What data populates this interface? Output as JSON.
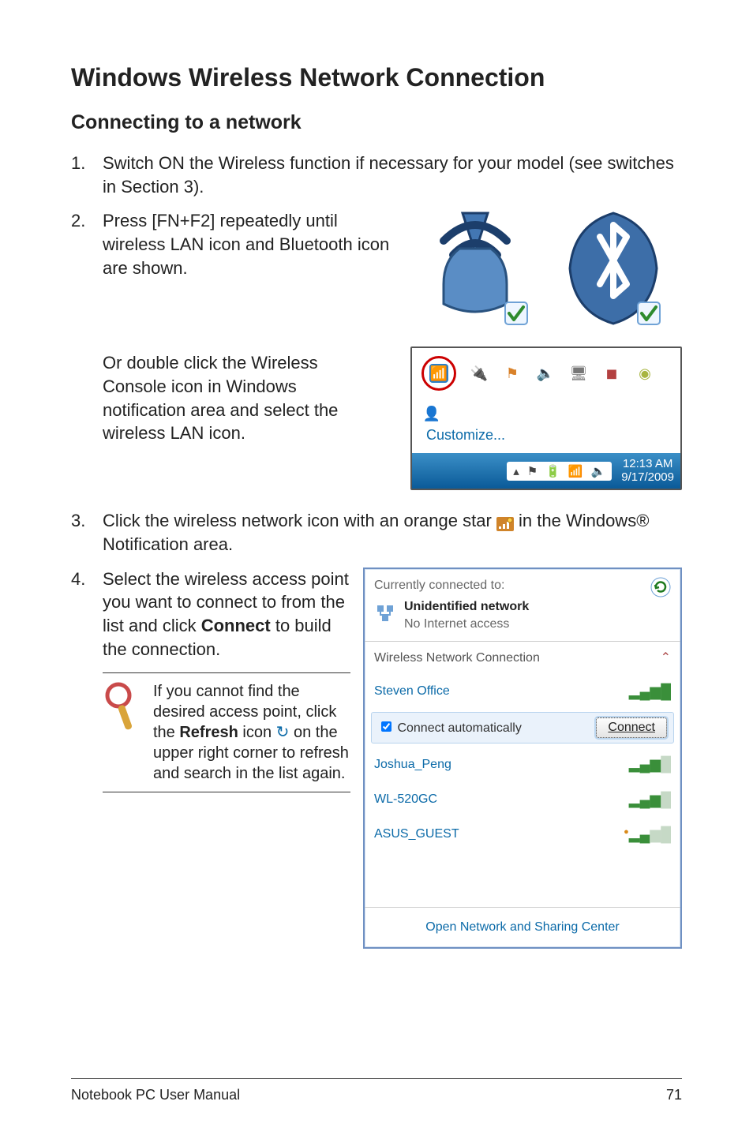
{
  "headings": {
    "h1": "Windows Wireless Network Connection",
    "h2": "Connecting to a network"
  },
  "steps": {
    "s1": {
      "num": "1.",
      "text": "Switch ON the Wireless function if necessary for your model (see switches in Section 3)."
    },
    "s2": {
      "num": "2.",
      "text": "Press [FN+F2] repeatedly until wireless LAN icon and Bluetooth icon are shown."
    },
    "s2b": "Or double click the Wireless Console icon in Windows notification area and select the wireless LAN icon.",
    "s3": {
      "num": "3.",
      "pre": "Click the wireless network icon with an orange star ",
      "post": " in the Windows® Notification area."
    },
    "s4": {
      "num": "4.",
      "pre": "Select the wireless access point you want to connect to from the list and click ",
      "bold": "Connect",
      "post": " to build the connection."
    }
  },
  "tip": {
    "pre": "If you cannot find the desired access point, click the ",
    "bold": "Refresh",
    "mid": " icon ",
    "post": " on the upper right corner to refresh and search in the list again."
  },
  "tray": {
    "customize": "Customize...",
    "time": "12:13 AM",
    "date": "9/17/2009"
  },
  "netpopup": {
    "connected_label": "Currently connected to:",
    "unidentified": "Unidentified network",
    "noaccess": "No Internet access",
    "section_label": "Wireless Network Connection",
    "auto_label": " Connect automatically",
    "connect_btn": "Connect",
    "items": [
      "Steven Office",
      "Joshua_Peng",
      "WL-520GC",
      "ASUS_GUEST"
    ],
    "footer": "Open Network and Sharing Center"
  },
  "footer": {
    "left": "Notebook PC User Manual",
    "right": "71"
  }
}
